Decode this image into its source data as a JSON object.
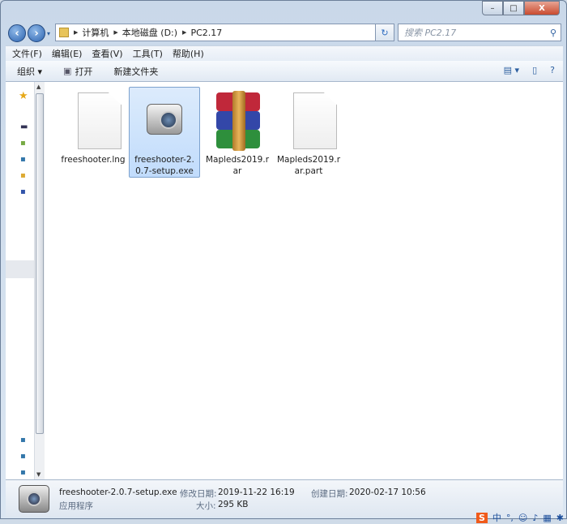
{
  "window": {
    "minimize": "–",
    "maximize": "□",
    "close": "X"
  },
  "address": {
    "breadcrumbs": [
      "计算机",
      "本地磁盘 (D:)",
      "PC2.17"
    ],
    "refresh": "↻",
    "search_placeholder": "搜索 PC2.17"
  },
  "menu": [
    "文件(F)",
    "编辑(E)",
    "查看(V)",
    "工具(T)",
    "帮助(H)"
  ],
  "toolbar": {
    "organize": "组织 ▾",
    "open": "打开",
    "new_folder": "新建文件夹"
  },
  "files": [
    {
      "name": "freeshooter.lng",
      "icon": "document-icon",
      "selected": false
    },
    {
      "name": "freeshooter-2.0.7-setup.exe",
      "icon": "camera-icon",
      "selected": true
    },
    {
      "name": "Mapleds2019.rar",
      "icon": "winrar-icon",
      "selected": false
    },
    {
      "name": "Mapleds2019.rar.part",
      "icon": "document-icon",
      "selected": false
    }
  ],
  "details": {
    "name": "freeshooter-2.0.7-setup.exe",
    "type": "应用程序",
    "modified_label": "修改日期:",
    "modified": "2019-11-22 16:19",
    "created_label": "创建日期:",
    "created": "2020-02-17 10:56",
    "size_label": "大小:",
    "size": "295 KB"
  },
  "tray": {
    "ime": "S",
    "lang": "中"
  }
}
